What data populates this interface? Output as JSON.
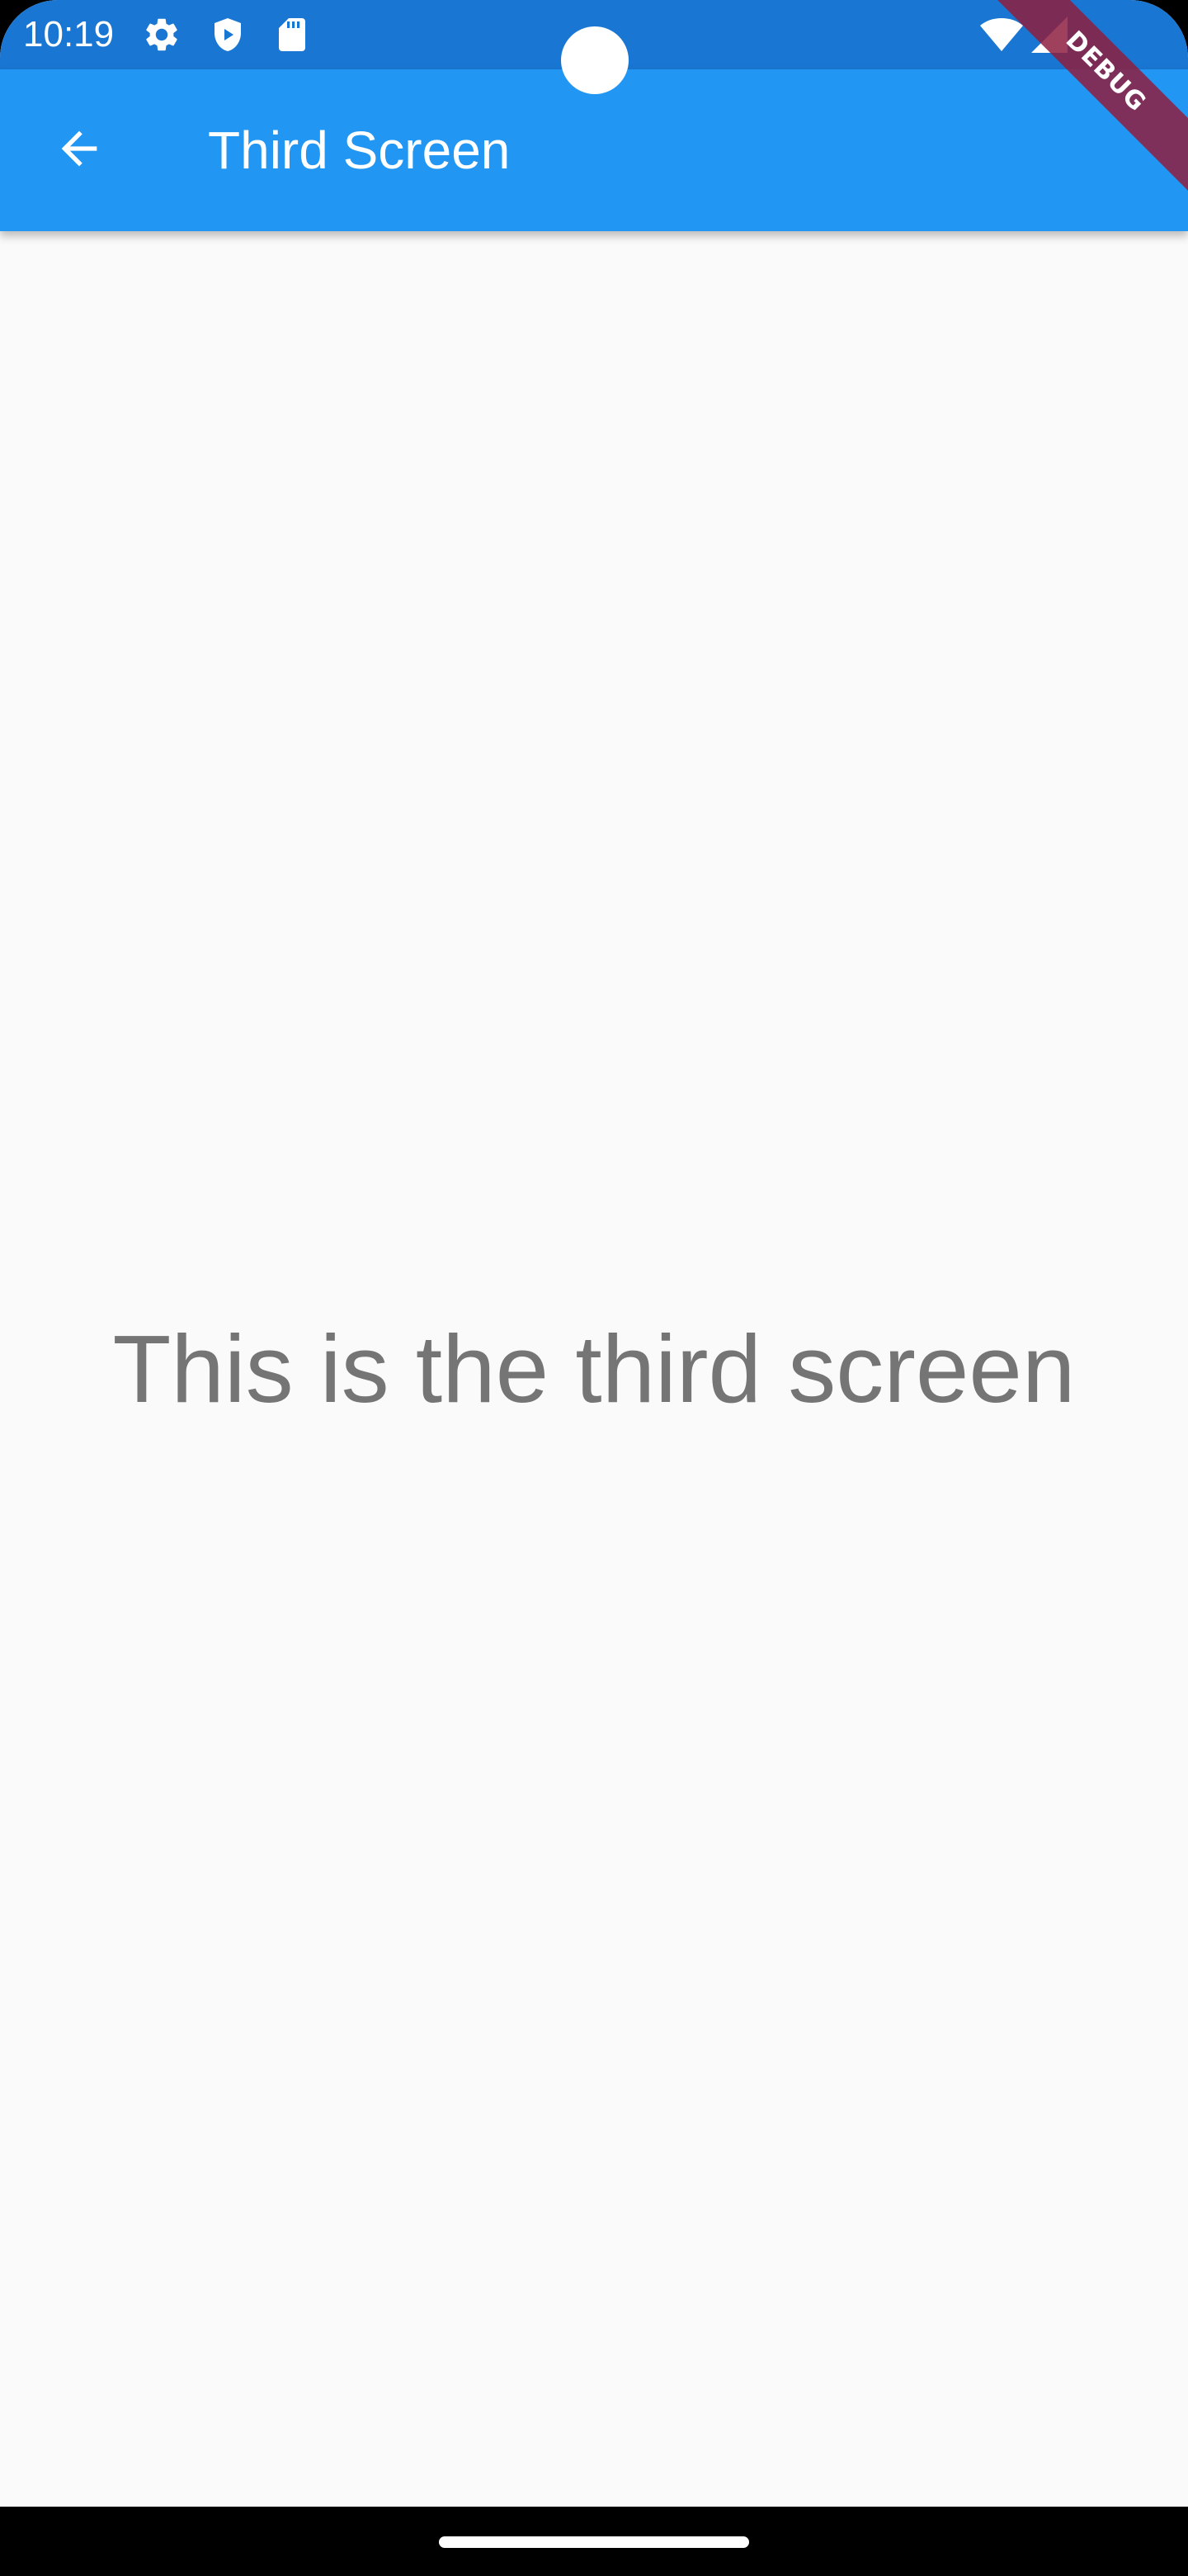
{
  "status_bar": {
    "time": "10:19",
    "icons_left": [
      "gear-icon",
      "play-protect-icon",
      "sd-card-icon"
    ],
    "icons_right": [
      "wifi-icon",
      "signal-icon"
    ]
  },
  "app_bar": {
    "title": "Third Screen",
    "back_icon": "arrow-back-icon",
    "color": "#2196f3"
  },
  "debug_banner": {
    "label": "DEBUG"
  },
  "body": {
    "text": "This is the third screen"
  },
  "colors": {
    "status_bar": "#1976d2",
    "app_bar": "#2196f3",
    "background": "#fafafa",
    "body_text": "#757575"
  }
}
